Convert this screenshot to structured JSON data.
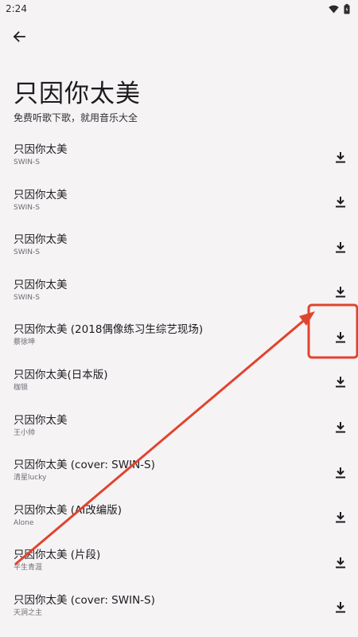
{
  "status_bar": {
    "time": "2:24"
  },
  "header": {
    "title": "只因你太美",
    "subtitle": "免费听歌下歌，就用音乐大全"
  },
  "songs": [
    {
      "title": "只因你太美",
      "artist": "SWIN-S"
    },
    {
      "title": "只因你太美",
      "artist": "SWIN-S"
    },
    {
      "title": "只因你太美",
      "artist": "SWIN-S"
    },
    {
      "title": "只因你太美",
      "artist": "SWIN-S"
    },
    {
      "title": "只因你太美 (2018偶像练习生综艺现场)",
      "artist": "蔡徐坤"
    },
    {
      "title": "只因你太美(日本版)",
      "artist": "枷锁"
    },
    {
      "title": "只因你太美",
      "artist": "王小帅"
    },
    {
      "title": "只因你太美 (cover: SWIN-S)",
      "artist": "清星lucky"
    },
    {
      "title": "只因你太美 (AI改编版)",
      "artist": "Alone"
    },
    {
      "title": "只因你太美 (片段)",
      "artist": "平生青涯"
    },
    {
      "title": "只因你太美 (cover: SWIN-S)",
      "artist": "天涧之主"
    }
  ],
  "icons": {
    "back": "arrow-left-icon",
    "download": "download-icon",
    "wifi": "wifi-icon",
    "battery": "battery-icon"
  },
  "colors": {
    "annotation": "#e0442e",
    "background": "#f6f3f5"
  }
}
